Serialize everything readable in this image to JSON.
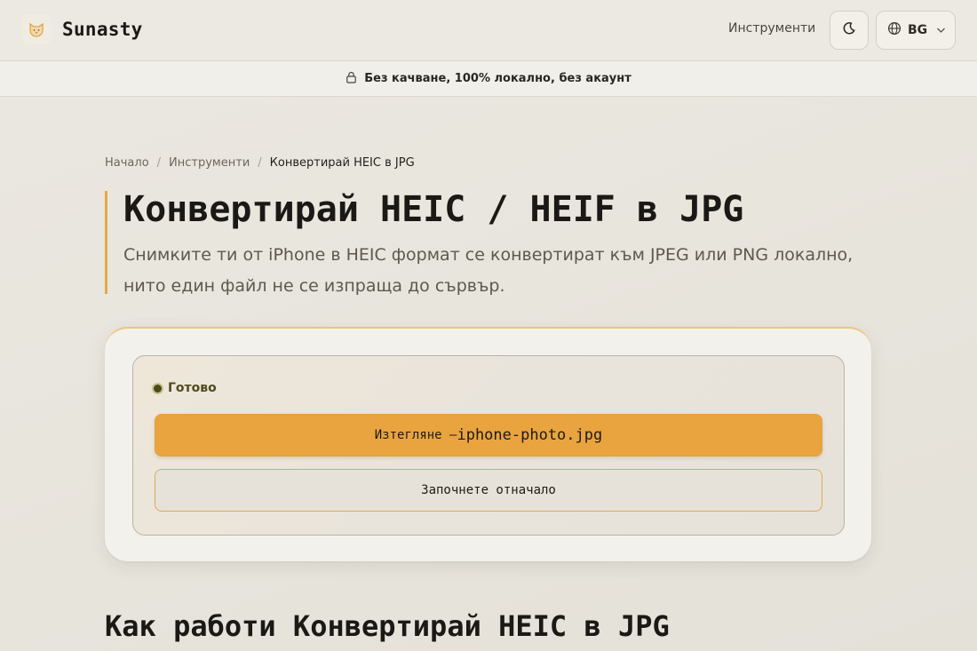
{
  "header": {
    "brand_name": "Sunasty",
    "nav_tools": "Инструменти",
    "language": "BG"
  },
  "privacy_banner": {
    "text": "Без качване, 100% локално, без акаунт"
  },
  "breadcrumb": {
    "items": [
      "Начало",
      "Инструменти",
      "Конвертирай HEIC в JPG"
    ],
    "separator": "/"
  },
  "hero": {
    "title": "Конвертирай HEIC / HEIF в JPG",
    "subtitle": "Снимките ти от iPhone в HEIC формат се конвертират към JPEG или PNG локално, нито един файл не се изпраща до сървър."
  },
  "tool": {
    "status": "Готово",
    "download_prefix": "Изтегляне — ",
    "download_filename": "iphone-photo.jpg",
    "restart_label": "Започнете отначало"
  },
  "section": {
    "title": "Как работи Конвертирай HEIC в JPG"
  },
  "colors": {
    "accent": "#e9a43f",
    "status_dot": "#4a4a1c",
    "background": "#e9e6df"
  },
  "icons": {
    "logo": "cat-logo-icon",
    "theme": "moon-icon",
    "language": "globe-icon",
    "dropdown": "chevron-down-icon",
    "privacy": "lock-icon"
  }
}
